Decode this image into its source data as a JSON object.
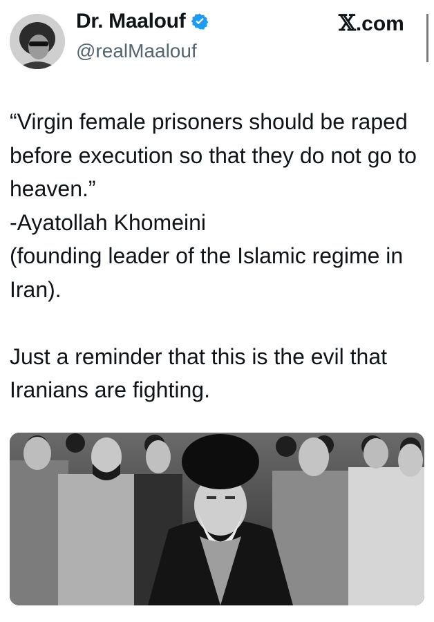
{
  "header": {
    "display_name": "Dr. Maalouf",
    "handle": "@realMaalouf",
    "site": "X.com",
    "site_glyph": "𝕏",
    "site_suffix": ".com",
    "verified_icon": "verified-badge-icon",
    "verified_color": "#1d9bf0"
  },
  "tweet": {
    "lines": [
      "“Virgin female prisoners should be raped before execution so that they do not go to heaven.”",
      "-Ayatollah Khomeini",
      "(founding leader of the Islamic regime in Iran).",
      "",
      "Just a reminder that this is the evil that Iranians are fighting."
    ]
  },
  "media": {
    "kind": "black-and-white photograph",
    "icon": "photo-icon"
  }
}
